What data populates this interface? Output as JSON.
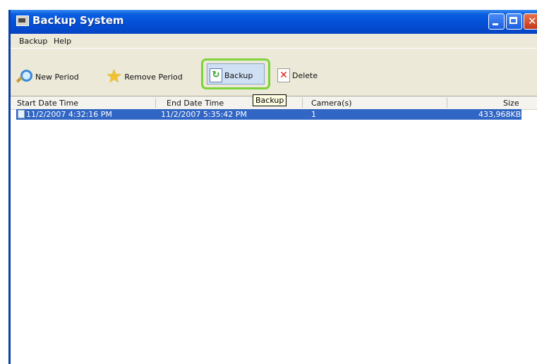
{
  "window": {
    "title": "Backup System"
  },
  "menu": {
    "backup_label": "Backup",
    "help_label": "Help"
  },
  "toolbar": {
    "new_period_label": "New Period",
    "remove_period_label": "Remove Period",
    "backup_label": "Backup",
    "delete_label": "Delete"
  },
  "tooltip": {
    "text": "Backup"
  },
  "table": {
    "columns": [
      "Start Date Time",
      "End Date Time",
      "Camera(s)",
      "Size"
    ],
    "rows": [
      {
        "start": "11/2/2007 4:32:16 PM",
        "end": "11/2/2007 5:35:42 PM",
        "cameras": "1",
        "size": "433,968KB"
      }
    ]
  },
  "colors": {
    "titlebar": "#0450d8",
    "selection": "#3166c4",
    "highlight_ring": "#7ed23a"
  },
  "icons": [
    "window-icon",
    "minimize-icon",
    "maximize-icon",
    "close-icon",
    "magnifier-icon",
    "star-icon",
    "refresh-icon",
    "delete-x-icon",
    "document-icon"
  ]
}
